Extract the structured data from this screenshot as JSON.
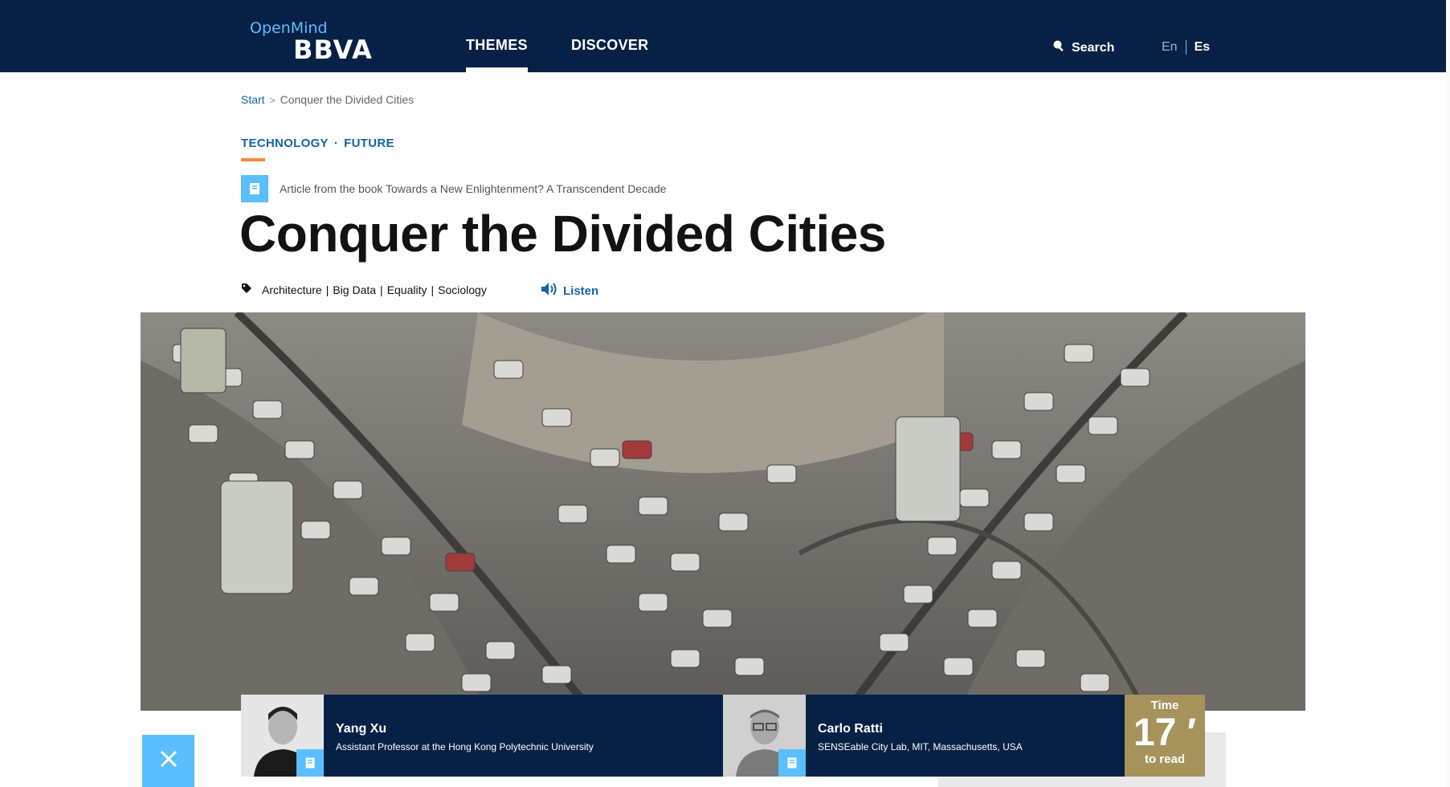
{
  "header": {
    "logo_top": "OpenMind",
    "logo_bottom": "BBVA",
    "nav": [
      "THEMES",
      "DISCOVER"
    ],
    "search_label": "Search",
    "lang_en": "En",
    "lang_es": "Es"
  },
  "breadcrumb": {
    "start": "Start",
    "separator": ">",
    "current": "Conquer the Divided Cities"
  },
  "categories": [
    "TECHNOLOGY",
    "FUTURE"
  ],
  "category_sep": "·",
  "book_note": "Article from the book Towards a New Enlightenment? A Transcendent Decade",
  "title": "Conquer the Divided Cities",
  "tags": [
    "Architecture",
    "Big Data",
    "Equality",
    "Sociology"
  ],
  "tag_sep": "|",
  "listen_label": "Listen",
  "authors": [
    {
      "name": "Yang Xu",
      "role": "Assistant Professor at the Hong Kong Polytechnic University"
    },
    {
      "name": "Carlo Ratti",
      "role": "SENSEable City Lab, MIT, Massachusetts, USA"
    }
  ],
  "reading_time": {
    "label": "Time",
    "value": "17 ′",
    "sub": "to read"
  },
  "colors": {
    "navy": "#072146",
    "accent_blue": "#5bbeff",
    "link_blue": "#1464a5",
    "orange": "#f7893b",
    "gold": "#a5935b"
  }
}
